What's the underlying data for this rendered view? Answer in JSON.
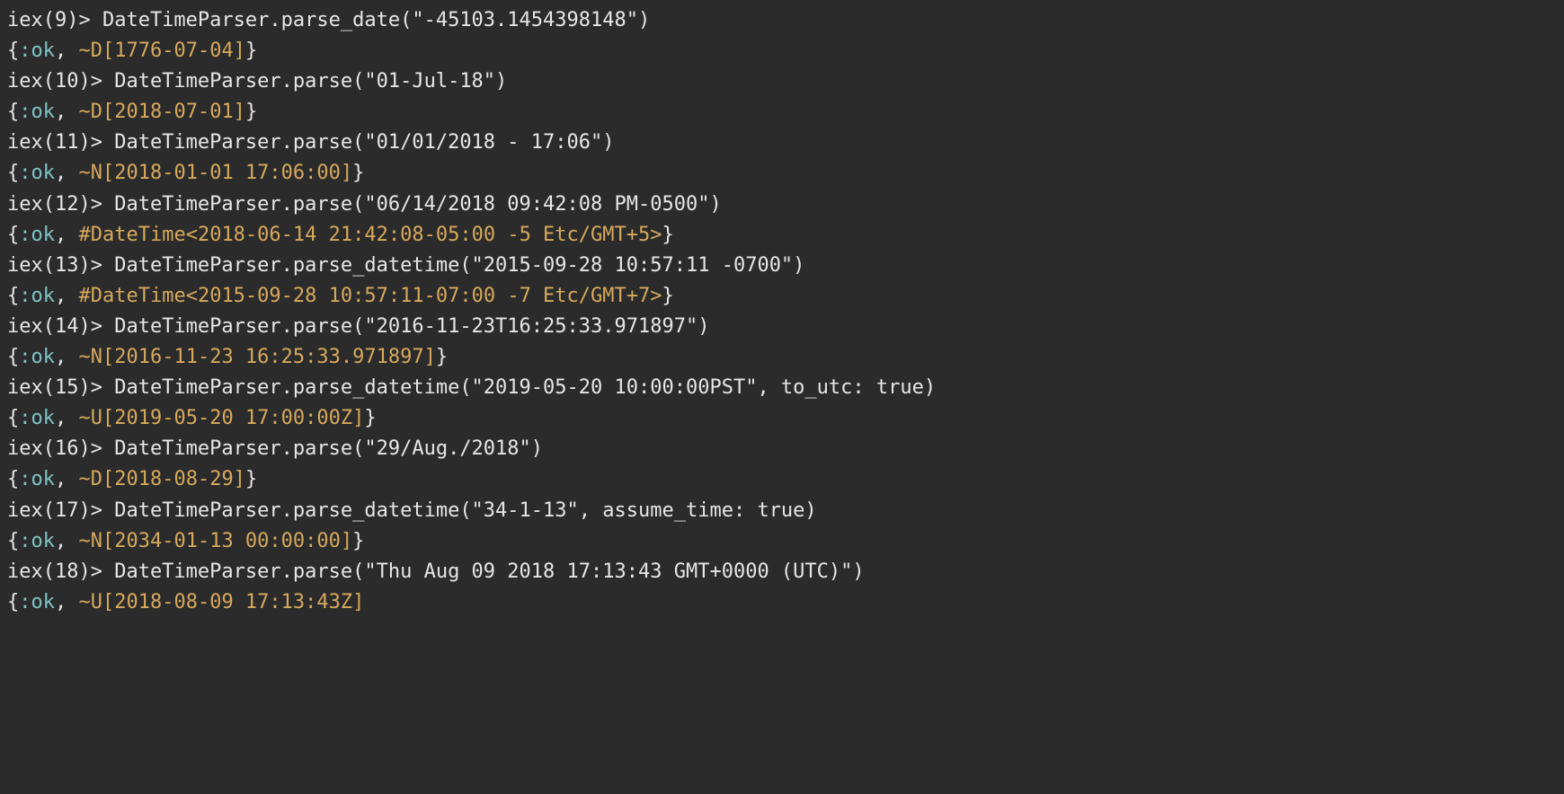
{
  "lines": [
    {
      "segments": [
        {
          "text": "iex(9)> DateTimeParser.parse_date(\"-45103.1454398148\")",
          "cls": "c-default"
        }
      ]
    },
    {
      "segments": [
        {
          "text": "{",
          "cls": "c-brace"
        },
        {
          "text": ":ok",
          "cls": "c-atom"
        },
        {
          "text": ", ",
          "cls": "c-punc"
        },
        {
          "text": "~D[1776-07-04]",
          "cls": "c-sigil"
        },
        {
          "text": "}",
          "cls": "c-brace"
        }
      ]
    },
    {
      "segments": [
        {
          "text": "iex(10)> DateTimeParser.parse(\"01-Jul-18\")",
          "cls": "c-default"
        }
      ]
    },
    {
      "segments": [
        {
          "text": "{",
          "cls": "c-brace"
        },
        {
          "text": ":ok",
          "cls": "c-atom"
        },
        {
          "text": ", ",
          "cls": "c-punc"
        },
        {
          "text": "~D[2018-07-01]",
          "cls": "c-sigil"
        },
        {
          "text": "}",
          "cls": "c-brace"
        }
      ]
    },
    {
      "segments": [
        {
          "text": "iex(11)> DateTimeParser.parse(\"01/01/2018 - 17:06\")",
          "cls": "c-default"
        }
      ]
    },
    {
      "segments": [
        {
          "text": "{",
          "cls": "c-brace"
        },
        {
          "text": ":ok",
          "cls": "c-atom"
        },
        {
          "text": ", ",
          "cls": "c-punc"
        },
        {
          "text": "~N[2018-01-01 17:06:00]",
          "cls": "c-sigil"
        },
        {
          "text": "}",
          "cls": "c-brace"
        }
      ]
    },
    {
      "segments": [
        {
          "text": "iex(12)> DateTimeParser.parse(\"06/14/2018 09:42:08 PM-0500\")",
          "cls": "c-default"
        }
      ]
    },
    {
      "segments": [
        {
          "text": "{",
          "cls": "c-brace"
        },
        {
          "text": ":ok",
          "cls": "c-atom"
        },
        {
          "text": ", ",
          "cls": "c-punc"
        },
        {
          "text": "#DateTime<2018-06-14 21:42:08-05:00 -5 Etc/GMT+5>",
          "cls": "c-sigil"
        },
        {
          "text": "}",
          "cls": "c-brace"
        }
      ]
    },
    {
      "segments": [
        {
          "text": "iex(13)> DateTimeParser.parse_datetime(\"2015-09-28 10:57:11 -0700\")",
          "cls": "c-default"
        }
      ]
    },
    {
      "segments": [
        {
          "text": "{",
          "cls": "c-brace"
        },
        {
          "text": ":ok",
          "cls": "c-atom"
        },
        {
          "text": ", ",
          "cls": "c-punc"
        },
        {
          "text": "#DateTime<2015-09-28 10:57:11-07:00 -7 Etc/GMT+7>",
          "cls": "c-sigil"
        },
        {
          "text": "}",
          "cls": "c-brace"
        }
      ]
    },
    {
      "segments": [
        {
          "text": "iex(14)> DateTimeParser.parse(\"2016-11-23T16:25:33.971897\")",
          "cls": "c-default"
        }
      ]
    },
    {
      "segments": [
        {
          "text": "{",
          "cls": "c-brace"
        },
        {
          "text": ":ok",
          "cls": "c-atom"
        },
        {
          "text": ", ",
          "cls": "c-punc"
        },
        {
          "text": "~N[2016-11-23 16:25:33.971897]",
          "cls": "c-sigil"
        },
        {
          "text": "}",
          "cls": "c-brace"
        }
      ]
    },
    {
      "segments": [
        {
          "text": "iex(15)> DateTimeParser.parse_datetime(\"2019-05-20 10:00:00PST\", to_utc: true)",
          "cls": "c-default"
        }
      ]
    },
    {
      "segments": [
        {
          "text": "{",
          "cls": "c-brace"
        },
        {
          "text": ":ok",
          "cls": "c-atom"
        },
        {
          "text": ", ",
          "cls": "c-punc"
        },
        {
          "text": "~U[2019-05-20 17:00:00Z]",
          "cls": "c-sigil"
        },
        {
          "text": "}",
          "cls": "c-brace"
        }
      ]
    },
    {
      "segments": [
        {
          "text": "iex(16)> DateTimeParser.parse(\"29/Aug./2018\")",
          "cls": "c-default"
        }
      ]
    },
    {
      "segments": [
        {
          "text": "{",
          "cls": "c-brace"
        },
        {
          "text": ":ok",
          "cls": "c-atom"
        },
        {
          "text": ", ",
          "cls": "c-punc"
        },
        {
          "text": "~D[2018-08-29]",
          "cls": "c-sigil"
        },
        {
          "text": "}",
          "cls": "c-brace"
        }
      ]
    },
    {
      "segments": [
        {
          "text": "iex(17)> DateTimeParser.parse_datetime(\"34-1-13\", assume_time: true)",
          "cls": "c-default"
        }
      ]
    },
    {
      "segments": [
        {
          "text": "{",
          "cls": "c-brace"
        },
        {
          "text": ":ok",
          "cls": "c-atom"
        },
        {
          "text": ", ",
          "cls": "c-punc"
        },
        {
          "text": "~N[2034-01-13 00:00:00]",
          "cls": "c-sigil"
        },
        {
          "text": "}",
          "cls": "c-brace"
        }
      ]
    },
    {
      "segments": [
        {
          "text": "iex(18)> DateTimeParser.parse(\"Thu Aug 09 2018 17:13:43 GMT+0000 (UTC)\")",
          "cls": "c-default"
        }
      ]
    },
    {
      "segments": [
        {
          "text": "{",
          "cls": "c-brace"
        },
        {
          "text": ":ok",
          "cls": "c-atom"
        },
        {
          "text": ", ",
          "cls": "c-punc"
        },
        {
          "text": "~U[2018-08-09 17:13:43Z]",
          "cls": "c-sigil"
        }
      ]
    }
  ]
}
